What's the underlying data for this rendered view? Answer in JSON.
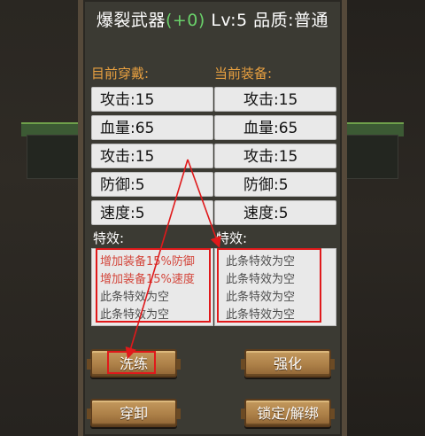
{
  "header": {
    "item_name": "爆裂武器",
    "enhance": "(+0)",
    "level": "Lv:5",
    "quality": "品质:普通"
  },
  "current_worn": {
    "header": "目前穿戴:",
    "stats": [
      "攻击:15",
      "血量:65",
      "攻击:15",
      "防御:5",
      "速度:5"
    ],
    "special_label": "特效:",
    "specials": [
      "增加装备15%防御",
      "增加装备15%速度",
      "此条特效为空",
      "此条特效为空"
    ]
  },
  "current_equip": {
    "header": "当前装备:",
    "stats": [
      "攻击:15",
      "血量:65",
      "攻击:15",
      "防御:5",
      "速度:5"
    ],
    "special_label": "特效:",
    "specials": [
      "此条特效为空",
      "此条特效为空",
      "此条特效为空",
      "此条特效为空"
    ]
  },
  "buttons": {
    "refine": "洗练",
    "enhance": "强化",
    "wear_unwear": "穿卸",
    "lock_unlock": "锁定/解绑"
  },
  "colors": {
    "accent_header": "#e8a040",
    "enhance_green": "#6ad16a",
    "special_active": "#d3463b",
    "annotation_red": "#e0191b"
  }
}
